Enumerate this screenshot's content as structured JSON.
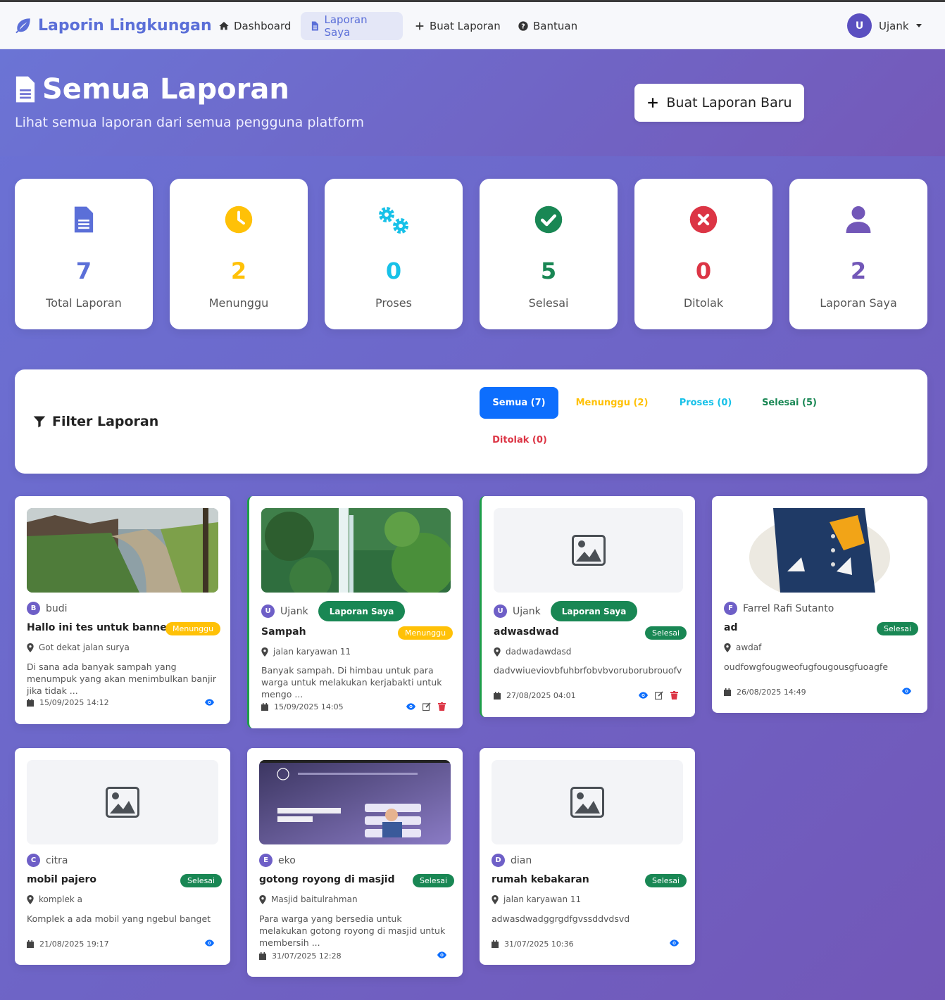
{
  "nav": {
    "brand": "Laporin Lingkungan",
    "items": [
      "Dashboard",
      "Laporan Saya",
      "Buat Laporan",
      "Bantuan"
    ],
    "user": "Ujank",
    "user_initial": "U"
  },
  "hero": {
    "title": "Semua Laporan",
    "subtitle": "Lihat semua laporan dari semua pengguna platform",
    "button": "Buat Laporan Baru"
  },
  "stats": [
    {
      "value": "7",
      "label": "Total Laporan",
      "color": "#5b6fd8"
    },
    {
      "value": "2",
      "label": "Menunggu",
      "color": "#ffc107"
    },
    {
      "value": "0",
      "label": "Proses",
      "color": "#17c1e8"
    },
    {
      "value": "5",
      "label": "Selesai",
      "color": "#198754"
    },
    {
      "value": "0",
      "label": "Ditolak",
      "color": "#dc3545"
    },
    {
      "value": "2",
      "label": "Laporan Saya",
      "color": "#7257b8"
    }
  ],
  "filter": {
    "title": "Filter Laporan",
    "buttons": [
      "Semua (7)",
      "Menunggu (2)",
      "Proses (0)",
      "Selesai (5)",
      "Ditolak (0)"
    ]
  },
  "mine_label": "Laporan Saya",
  "cards": [
    {
      "user": "budi",
      "initial": "B",
      "title": "Hallo ini tes untuk banner",
      "status": "Menunggu",
      "location": "Got dekat jalan surya",
      "desc": "Di sana ada banyak sampah yang menumpuk yang akan menimbulkan banjir jika tidak ...",
      "date": "15/09/2025 14:12"
    },
    {
      "user": "Ujank",
      "initial": "U",
      "title": "Sampah",
      "status": "Menunggu",
      "location": "jalan karyawan 11",
      "desc": "Banyak sampah. Di himbau untuk para warga untuk melakukan kerjabakti untuk mengo ...",
      "date": "15/09/2025 14:05"
    },
    {
      "user": "Ujank",
      "initial": "U",
      "title": "adwasdwad",
      "status": "Selesai",
      "location": "dadwadawdasd",
      "desc": "dadvwiueviovbfuhbrfobvbvoruborubrouofv",
      "date": "27/08/2025 04:01"
    },
    {
      "user": "Farrel Rafi Sutanto",
      "initial": "F",
      "title": "ad",
      "status": "Selesai",
      "location": "awdaf",
      "desc": "oudfowgfougweofugfougousgfuoagfe",
      "date": "26/08/2025 14:49"
    },
    {
      "user": "citra",
      "initial": "C",
      "title": "mobil pajero",
      "status": "Selesai",
      "location": "komplek a",
      "desc": "Komplek a ada mobil yang ngebul banget",
      "date": "21/08/2025 19:17"
    },
    {
      "user": "eko",
      "initial": "E",
      "title": "gotong royong di masjid",
      "status": "Selesai",
      "location": "Masjid baitulrahman",
      "desc": "Para warga yang bersedia untuk melakukan gotong royong di masjid untuk membersih ...",
      "date": "31/07/2025 12:28"
    },
    {
      "user": "dian",
      "initial": "D",
      "title": "rumah kebakaran",
      "status": "Selesai",
      "location": "jalan karyawan 11",
      "desc": "adwasdwadggrgdfgvssddvdsvd",
      "date": "31/07/2025 10:36"
    }
  ],
  "colors": {
    "primary": "#0d6efd",
    "success": "#198754",
    "warning": "#ffc107",
    "danger": "#dc3545",
    "info": "#17c1e8"
  }
}
